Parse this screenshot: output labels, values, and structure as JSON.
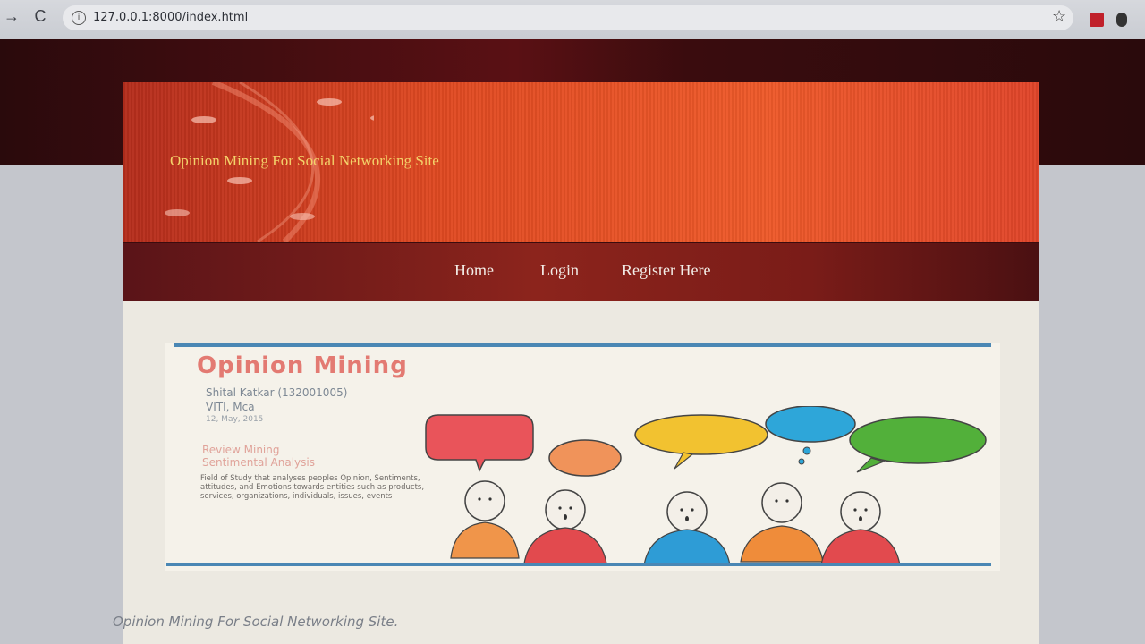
{
  "browser": {
    "url": "127.0.0.1:8000/index.html"
  },
  "site": {
    "title": "Opinion Mining For Social Networking Site",
    "nav": [
      {
        "label": "Home"
      },
      {
        "label": "Login"
      },
      {
        "label": "Register Here"
      }
    ],
    "footer_text": "Opinion Mining For Social Networking Site."
  },
  "slide": {
    "title": "Opinion Mining",
    "author": "Shital Katkar (132001005)",
    "course": "VITI, Mca",
    "date": "12, May, 2015",
    "topics": [
      "Review Mining",
      "Sentimental Analysis"
    ],
    "description": "Field of Study that analyses peoples Opinion, Sentiments, attitudes, and Emotions towards entities such as products, services, organizations, individuals, issues, events"
  }
}
